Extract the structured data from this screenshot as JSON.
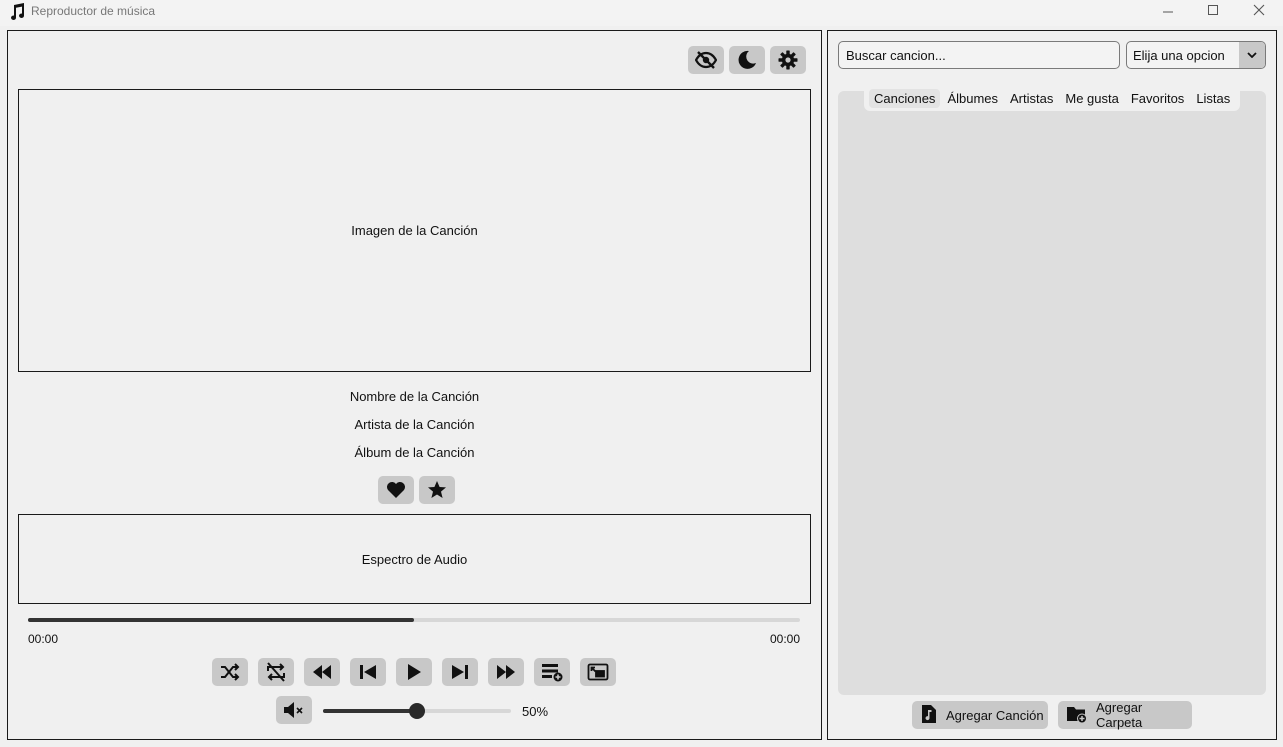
{
  "window": {
    "title": "Reproductor de música",
    "app_icon": "music-note-icon",
    "controls": [
      "minimize-icon",
      "maximize-icon",
      "close-icon"
    ]
  },
  "top_buttons": [
    {
      "icon": "eye-off-icon"
    },
    {
      "icon": "moon-icon"
    },
    {
      "icon": "gear-icon"
    }
  ],
  "song": {
    "image_label": "Imagen de la Canción",
    "name": "Nombre de la Canción",
    "artist": "Artista de la Canción",
    "album": "Álbum de la Canción"
  },
  "song_actions": [
    {
      "icon": "heart-icon"
    },
    {
      "icon": "star-icon"
    }
  ],
  "spectrum": {
    "label": "Espectro de Audio"
  },
  "progress": {
    "fraction": 0.5,
    "current_time": "00:00",
    "total_time": "00:00"
  },
  "transport": [
    {
      "icon": "shuffle-icon"
    },
    {
      "icon": "repeat-off-icon"
    },
    {
      "icon": "rewind-icon"
    },
    {
      "icon": "skip-previous-icon"
    },
    {
      "icon": "play-icon"
    },
    {
      "icon": "skip-next-icon"
    },
    {
      "icon": "fast-forward-icon"
    },
    {
      "icon": "queue-add-icon"
    },
    {
      "icon": "mini-player-icon"
    }
  ],
  "volume": {
    "icon": "volume-mute-icon",
    "fraction": 0.5,
    "label": "50%"
  },
  "library": {
    "search_placeholder": "Buscar cancion...",
    "select_value": "Elija una opcion",
    "tabs": [
      "Canciones",
      "Álbumes",
      "Artistas",
      "Me gusta",
      "Favoritos",
      "Listas"
    ],
    "active_tab": "Canciones",
    "add_song_label": "Agregar Canción",
    "add_folder_label": "Agregar Carpeta",
    "add_song_icon": "music-file-icon",
    "add_folder_icon": "folder-add-icon"
  },
  "colors": {
    "background": "#f0f0f0",
    "button": "#c8c8c8",
    "accent": "#333333",
    "tab_panel": "#dedede"
  }
}
